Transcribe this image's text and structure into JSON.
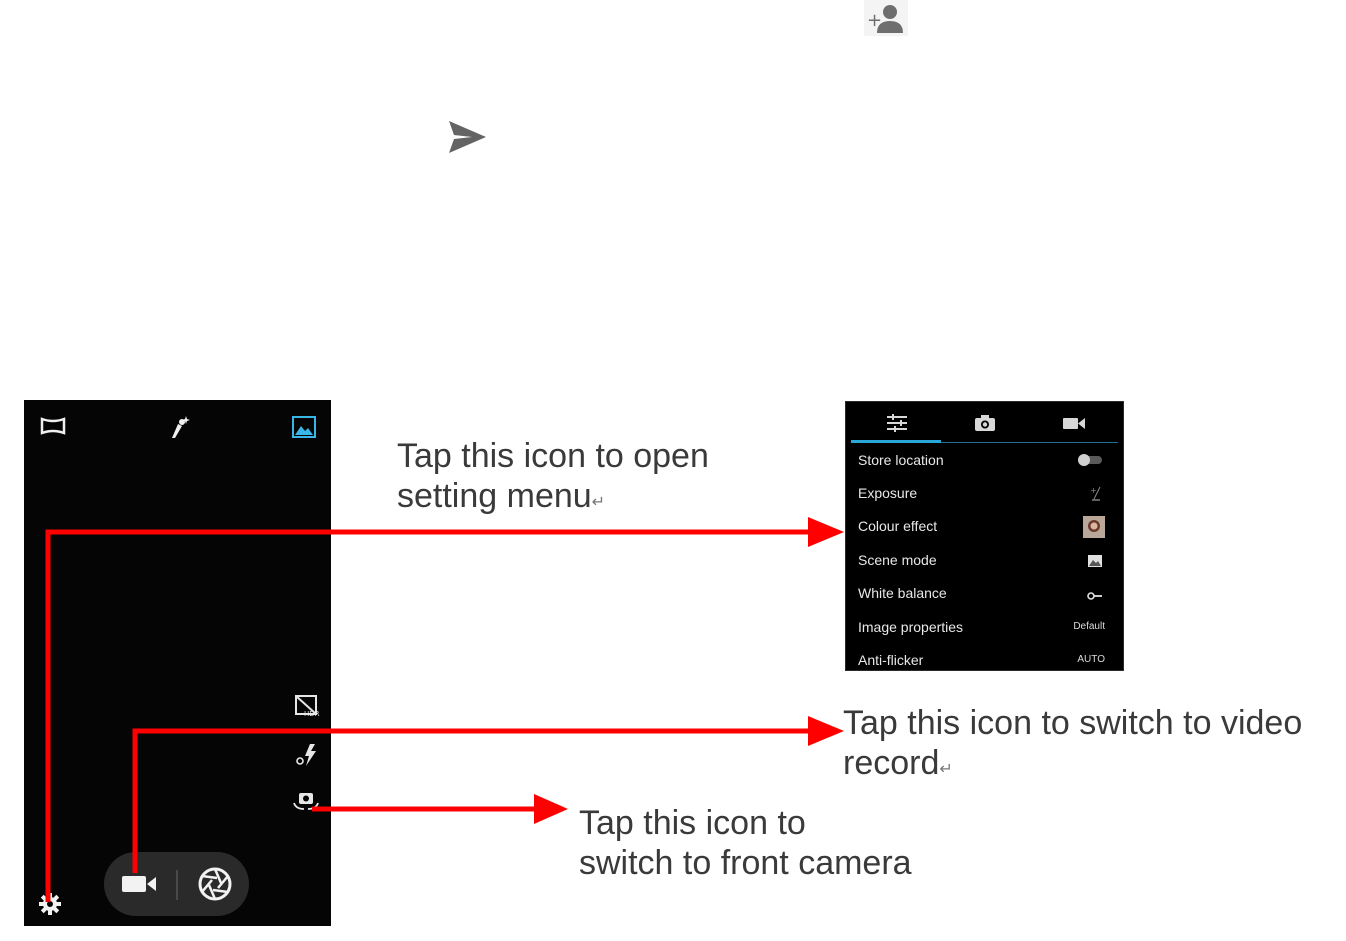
{
  "icons": {
    "top_icon": "add-person-icon",
    "send_icon": "send-icon"
  },
  "camera": {
    "top_icons": [
      "panorama-icon",
      "beauty-icon",
      "gallery-icon"
    ],
    "side_icons": [
      "hdr-icon",
      "flash-icon",
      "switch-camera-icon"
    ],
    "bottom_icons": [
      "settings-gear-icon",
      "video-icon",
      "shutter-icon"
    ]
  },
  "settings_panel": {
    "tabs": [
      "general-settings-tab",
      "photo-settings-tab",
      "video-settings-tab"
    ],
    "rows": [
      {
        "label": "Store location",
        "value": ""
      },
      {
        "label": "Exposure",
        "value": ""
      },
      {
        "label": "Colour effect",
        "value": ""
      },
      {
        "label": "Scene mode",
        "value": ""
      },
      {
        "label": "White balance",
        "value": ""
      },
      {
        "label": "Image properties",
        "value": "Default"
      },
      {
        "label": "Anti-flicker",
        "value": "AUTO"
      }
    ]
  },
  "annotations": {
    "settings_line1": "Tap this icon to open",
    "settings_line2": "setting menu",
    "video_line1": "Tap this icon to switch to video",
    "video_line2": "record",
    "front_line1": "Tap this icon to",
    "front_line2": "switch to front camera",
    "return_mark": "↵"
  },
  "colors": {
    "arrow": "#ff0000",
    "accent": "#2aa7d8",
    "screen_bg": "#050505"
  }
}
